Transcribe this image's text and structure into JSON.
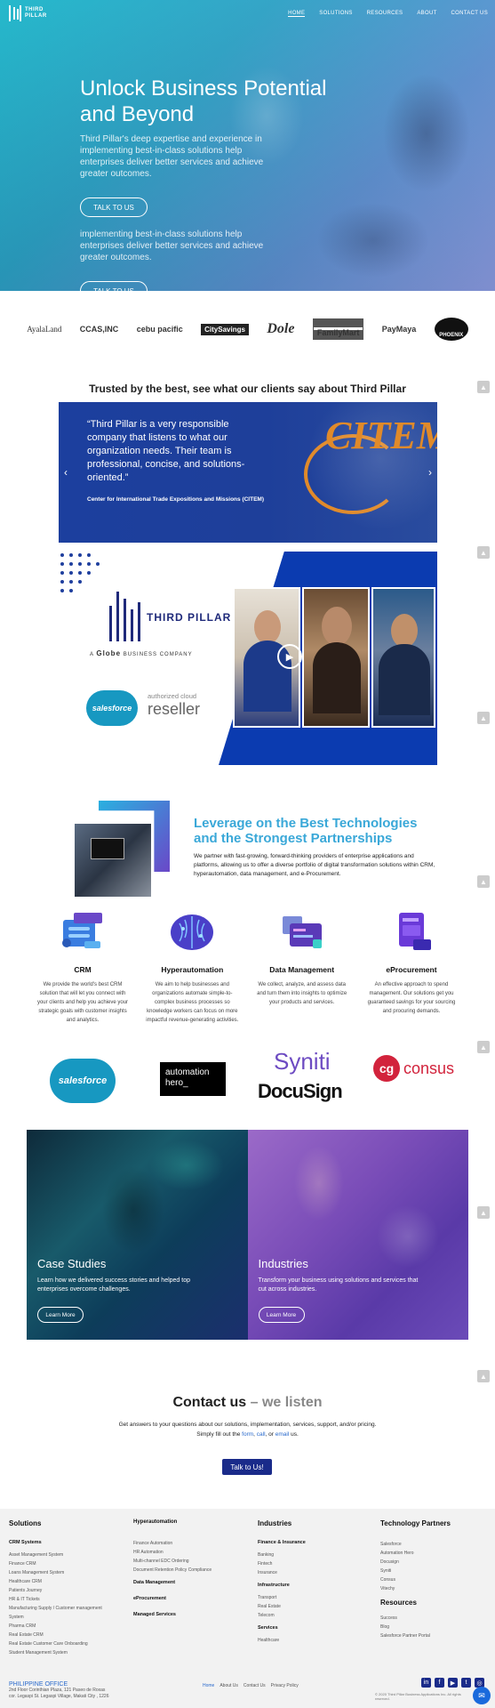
{
  "header": {
    "logo_text": "THIRD PILLAR",
    "nav": [
      "HOME",
      "SOLUTIONS",
      "RESOURCES",
      "ABOUT",
      "CONTACT US"
    ]
  },
  "hero": {
    "title": "Unlock Business Potential and Beyond",
    "subtitle": "Third Pillar's deep expertise and experience in implementing best-in-class solutions help enterprises deliver better services and achieve greater outcomes.",
    "cta": "TALK TO US",
    "subtitle_repeat": "implementing best-in-class solutions help enterprises deliver better services and achieve greater outcomes.",
    "cta_repeat": "TALK TO US"
  },
  "clients": [
    "AyalaLand",
    "CCAS,INC",
    "cebu pacific",
    "CitySavings",
    "Dole",
    "FamilyMart",
    "PayMaya",
    "PHOENIX"
  ],
  "testimonials": {
    "heading": "Trusted by the best, see what our clients say about Third Pillar",
    "quote": "“Third Pillar is a very responsible company that listens to what our organization needs. Their team is professional, concise, and solutions-oriented.”",
    "source": "Center for International Trade Expositions and Missions (CITEM)",
    "client_logo": "CITEM"
  },
  "video": {
    "brand": "THIRD PILLAR",
    "globe_prefix": "A",
    "globe": "Globe",
    "globe_suffix": "BUSINESS COMPANY",
    "salesforce": "salesforce",
    "reseller_small": "authorized cloud",
    "reseller": "reseller"
  },
  "leverage": {
    "title": "Leverage on the Best Technologies and the Strongest Partnerships",
    "text": "We partner with fast-growing, forward-thinking providers of enterprise applications and platforms, allowing us to offer a diverse portfolio of digital transformation solutions within CRM, hyperautomation, data management, and e-Procurement."
  },
  "solutions": [
    {
      "title": "CRM",
      "text": "We provide the world's best CRM solution that will let you connect with your clients and help you achieve your strategic goals with customer insights and analytics."
    },
    {
      "title": "Hyperautomation",
      "text": "We aim to help businesses and organizations automate simple-to-complex business processes so knowledge workers can focus on more impactful revenue-generating activities."
    },
    {
      "title": "Data Management",
      "text": "We collect, analyze, and assess data and turn them into insights to optimize your products and services."
    },
    {
      "title": "eProcurement",
      "text": "An effective approach to spend management. Our solutions get you guaranteed savings for your sourcing and procuring demands."
    }
  ],
  "partners": {
    "salesforce": "salesforce",
    "automation_hero": "automation hero_",
    "syniti": "Syniti",
    "docusign": "DocuSign",
    "cg": "cg",
    "consus": "consus"
  },
  "cards": [
    {
      "title": "Case Studies",
      "text": "Learn how we delivered success stories and helped top enterprises overcome challenges.",
      "button": "Learn More"
    },
    {
      "title": "Industries",
      "text": "Transform your business using solutions and services that cut across industries.",
      "button": "Learn More"
    }
  ],
  "contact": {
    "title": "Contact us",
    "title_dim": "– we listen",
    "text1": "Get answers to your questions about our solutions, implementation, services, support, and/or pricing.",
    "text2_prefix": "Simply fill out the ",
    "form_link": "form",
    "text2_mid": ", ",
    "call_link": "call",
    "text2_or": ", or ",
    "email_link": "email",
    "text2_suffix": " us.",
    "button": "Talk to Us!"
  },
  "footer": {
    "col1": {
      "title": "Solutions",
      "sub": "CRM Systems",
      "items": [
        "Asset Management System",
        "Finance CRM",
        "Loans Management System",
        "Healthcare CRM",
        "Patients Journey",
        "HR & IT Tickets",
        "Manufacturing Supply / Customer management System",
        "Pharma CRM",
        "Real Estate CRM",
        "Real Estate Customer Care Onboarding",
        "Student Management System"
      ]
    },
    "col2": {
      "title": "Hyperautomation",
      "items": [
        "Finance Automation",
        "HR Automation",
        "Multi-channel EDC Ordering",
        "Document Retention Policy Compliance"
      ],
      "sub2": "Data Management",
      "sub3": "eProcurement",
      "sub4": "Managed Services"
    },
    "col3": {
      "title": "Industries",
      "sub1": "Finance & Insurance",
      "items1": [
        "Banking",
        "Fintech",
        "Insurance"
      ],
      "sub2": "Infrastructure",
      "items2": [
        "Transport",
        "Real Estate",
        "Telecom"
      ],
      "sub3": "Services",
      "items3": [
        "Healthcare"
      ]
    },
    "col4": {
      "title": "Technology Partners",
      "items": [
        "Salesforce",
        "Automation Hero",
        "Docusign",
        "Syniti",
        "Consus",
        "Vitechy"
      ],
      "sub2": "Resources",
      "items2": [
        "Success",
        "Blog",
        "Salesforce Partner Portal"
      ]
    },
    "office_title": "PHILIPPINE OFFICE",
    "office_line1": "2nd Floor Corinthian Plaza, 121 Paseo de Roxas",
    "office_line2": "cor. Legaspi St. Legaspi Village, Makati City , 1226",
    "nav": [
      "Home",
      "About Us",
      "Contact Us",
      "Privacy Policy"
    ],
    "copyright": "© 2020 Third Pillar Business Applications Inc. All rights reserved.",
    "socials": [
      "in",
      "f",
      "▶",
      "t",
      "◎"
    ]
  },
  "colors": {
    "accent": "#3aa8d8",
    "brand_dark": "#1a2b8a",
    "hero_start": "#1ab5c9",
    "hero_end": "#8a9ae0"
  }
}
